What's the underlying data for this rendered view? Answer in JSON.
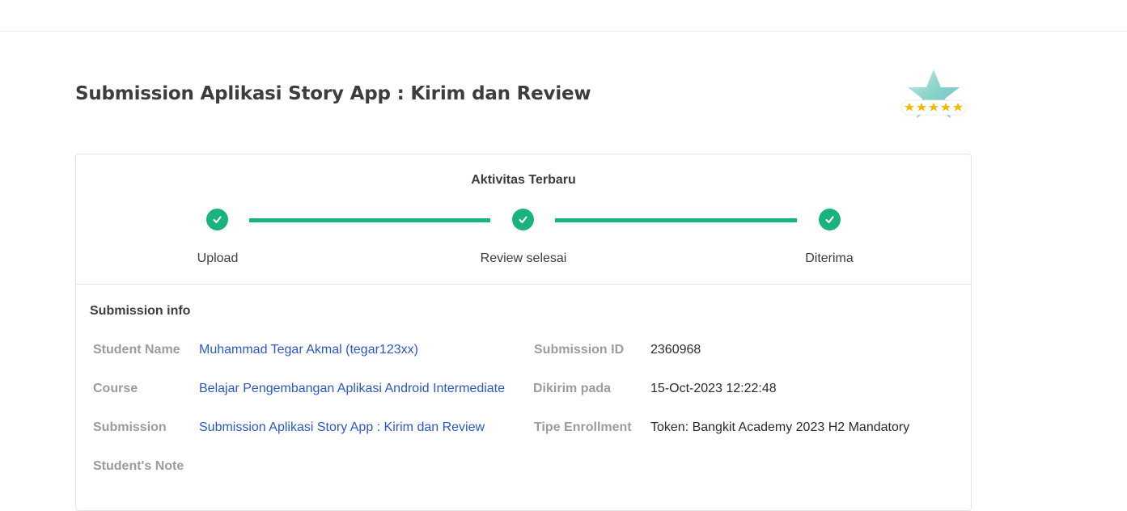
{
  "page": {
    "title": "Submission Aplikasi Story App : Kirim dan Review"
  },
  "activity": {
    "title": "Aktivitas Terbaru",
    "steps": [
      {
        "label": "Upload",
        "status": "done"
      },
      {
        "label": "Review selesai",
        "status": "done"
      },
      {
        "label": "Diterima",
        "status": "done"
      }
    ]
  },
  "submission_info": {
    "title": "Submission info",
    "student_name_label": "Student Name",
    "student_name_value": "Muhammad Tegar Akmal (tegar123xx)",
    "course_label": "Course",
    "course_value": "Belajar Pengembangan Aplikasi Android Intermediate",
    "submission_label": "Submission",
    "submission_value": "Submission Aplikasi Story App : Kirim dan Review",
    "student_note_label": "Student's Note",
    "submission_id_label": "Submission ID",
    "submission_id_value": "2360968",
    "sent_at_label": "Dikirim pada",
    "sent_at_value": "15-Oct-2023 12:22:48",
    "enrollment_type_label": "Tipe Enrollment",
    "enrollment_type_value": "Token: Bangkit Academy 2023 H2 Mandatory"
  },
  "badge": {
    "icon": "star-rating-badge-icon",
    "stars": 5
  },
  "colors": {
    "accent_green": "#18b47b",
    "link_blue": "#2a58c9",
    "label_gray": "#9a9ca3",
    "star_gold": "#f5b800"
  }
}
